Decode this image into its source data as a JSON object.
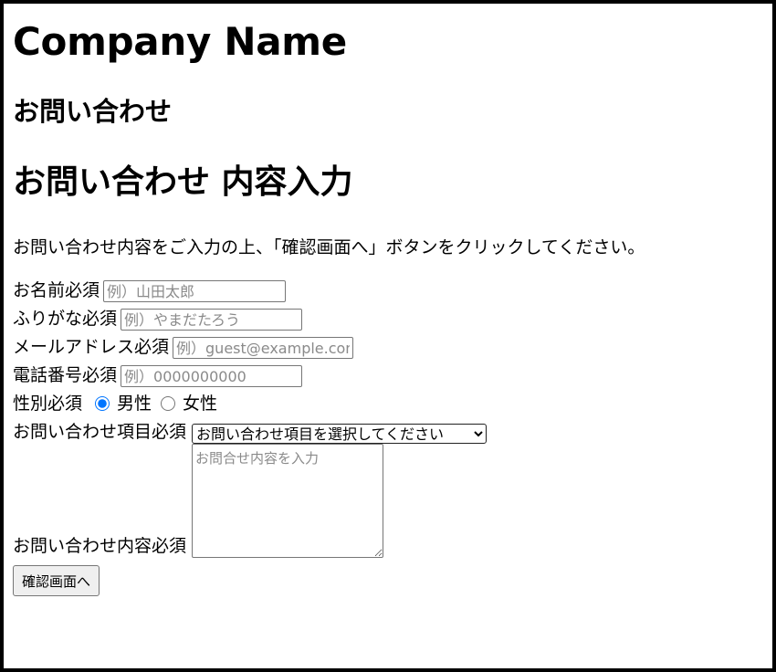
{
  "header": {
    "company_name": "Company Name"
  },
  "page": {
    "section_title": "お問い合わせ",
    "form_title": "お問い合わせ 内容入力",
    "instructions": "お問い合わせ内容をご入力の上、「確認画面へ」ボタンをクリックしてください。"
  },
  "form": {
    "name": {
      "label": "お名前必須",
      "placeholder": "例）山田太郎",
      "value": ""
    },
    "kana": {
      "label": "ふりがな必須",
      "placeholder": "例）やまだたろう",
      "value": ""
    },
    "email": {
      "label": "メールアドレス必須",
      "placeholder": "例）guest@example.com",
      "value": ""
    },
    "phone": {
      "label": "電話番号必須",
      "placeholder": "例）0000000000",
      "value": ""
    },
    "gender": {
      "label": "性別必須",
      "options": [
        {
          "label": "男性",
          "checked": true
        },
        {
          "label": "女性",
          "checked": false
        }
      ]
    },
    "inquiry_type": {
      "label": "お問い合わせ項目必須",
      "selected": "お問い合わせ項目を選択してください"
    },
    "message": {
      "label": "お問い合わせ内容必須",
      "placeholder": "お問合せ内容を入力",
      "value": ""
    },
    "submit_label": "確認画面へ"
  }
}
